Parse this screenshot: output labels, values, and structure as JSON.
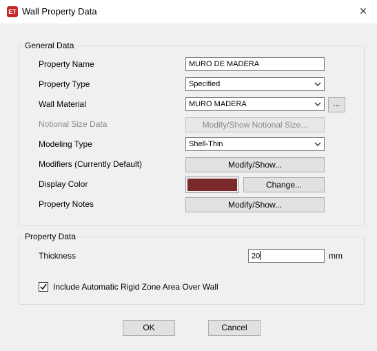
{
  "window": {
    "icon_text": "ET",
    "title": "Wall Property Data",
    "close_glyph": "×"
  },
  "general": {
    "legend": "General Data",
    "property_name_label": "Property Name",
    "property_name_value": "MURO DE MADERA",
    "property_type_label": "Property Type",
    "property_type_value": "Specified",
    "wall_material_label": "Wall Material",
    "wall_material_value": "MURO MADERA",
    "wall_material_more": "...",
    "notional_label": "Notional Size Data",
    "notional_button": "Modify/Show Notional Size...",
    "modeling_type_label": "Modeling Type",
    "modeling_type_value": "Shell-Thin",
    "modifiers_label": "Modifiers (Currently Default)",
    "modifiers_button": "Modify/Show...",
    "display_color_label": "Display Color",
    "display_color": "#7a2a2a",
    "change_button": "Change...",
    "notes_label": "Property Notes",
    "notes_button": "Modify/Show..."
  },
  "property": {
    "legend": "Property Data",
    "thickness_label": "Thickness",
    "thickness_value": "20",
    "thickness_unit": "mm"
  },
  "rigid_zone": {
    "checked": true,
    "label": "Include Automatic Rigid Zone Area Over Wall"
  },
  "buttons": {
    "ok": "OK",
    "cancel": "Cancel"
  }
}
